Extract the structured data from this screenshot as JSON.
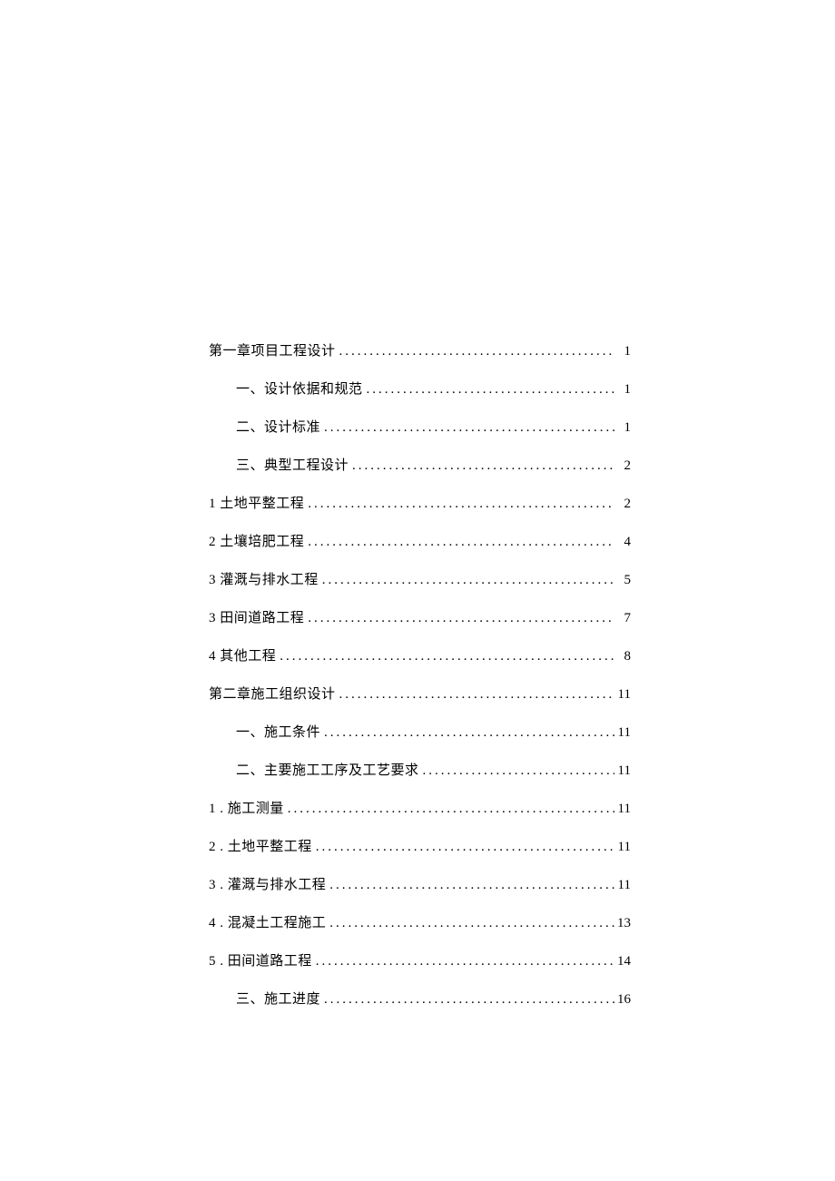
{
  "toc": [
    {
      "label": "第一章项目工程设计",
      "page": "1",
      "indent": false
    },
    {
      "label": "一、设计依据和规范",
      "page": "1",
      "indent": true
    },
    {
      "label": "二、设计标准",
      "page": "1",
      "indent": true
    },
    {
      "label": "三、典型工程设计",
      "page": "2",
      "indent": true
    },
    {
      "label": "1  土地平整工程",
      "page": "2",
      "indent": false
    },
    {
      "label": "2  土壤培肥工程",
      "page": "4",
      "indent": false
    },
    {
      "label": "3 灌溉与排水工程",
      "page": "5",
      "indent": false
    },
    {
      "label": "3 田间道路工程",
      "page": "7",
      "indent": false
    },
    {
      "label": "4 其他工程",
      "page": "8",
      "indent": false
    },
    {
      "label": "第二章施工组织设计",
      "page": "11",
      "indent": false
    },
    {
      "label": "一、施工条件",
      "page": "11",
      "indent": true
    },
    {
      "label": "二、主要施工工序及工艺要求",
      "page": "11",
      "indent": true
    },
    {
      "label": "1  . 施工测量",
      "page": "11",
      "indent": false
    },
    {
      "label": "2  . 土地平整工程",
      "page": "11",
      "indent": false
    },
    {
      "label": "3  . 灌溉与排水工程",
      "page": "11",
      "indent": false
    },
    {
      "label": "4  . 混凝土工程施工",
      "page": "13",
      "indent": false
    },
    {
      "label": "5  . 田间道路工程",
      "page": "14",
      "indent": false
    },
    {
      "label": "三、施工进度",
      "page": "16",
      "indent": true
    }
  ],
  "dots": "............................................................................................"
}
